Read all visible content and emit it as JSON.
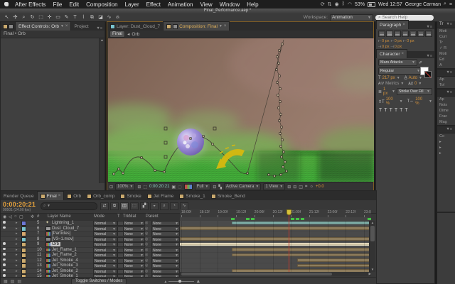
{
  "glyphs": {
    "dropdown": "▼",
    "close": "×",
    "panel_menu": "▼≡",
    "search": "⌕",
    "collapse": "▸",
    "up": "▲",
    "down": "▼",
    "left": "◀",
    "right": "▶",
    "crumb_sep": "◂",
    "pickwhip": "◎"
  },
  "menu_bar": {
    "items": [
      "After Effects",
      "File",
      "Edit",
      "Composition",
      "Layer",
      "Effect",
      "Animation",
      "View",
      "Window",
      "Help"
    ],
    "status_icons": [
      {
        "name": "sync-icon",
        "glyph": "⟳"
      },
      {
        "name": "updown-icon",
        "glyph": "⇅"
      },
      {
        "name": "info-icon",
        "glyph": "◉"
      },
      {
        "name": "bluetooth-icon",
        "glyph": "ᛒ"
      },
      {
        "name": "wifi-icon",
        "glyph": "◠"
      }
    ],
    "battery": "53%",
    "clock": "Wed 12:57",
    "user": "George Carman"
  },
  "title_bar": {
    "title": "Final_Performance.aep *"
  },
  "toolbar": {
    "tools": [
      {
        "name": "selection-tool",
        "glyph": "↖"
      },
      {
        "name": "hand-tool",
        "glyph": "✣"
      },
      {
        "name": "zoom-tool",
        "glyph": "⌕"
      },
      {
        "name": "rotation-tool",
        "glyph": "↻"
      },
      {
        "name": "camera-tool",
        "glyph": "⬚"
      },
      {
        "name": "pan-behind-tool",
        "glyph": "✛"
      },
      {
        "name": "shape-tool",
        "glyph": "▭"
      },
      {
        "name": "pen-tool",
        "glyph": "✎"
      },
      {
        "name": "type-tool",
        "glyph": "T"
      },
      {
        "name": "brush-tool",
        "glyph": "⌇"
      },
      {
        "name": "clone-stamp-tool",
        "glyph": "⧉"
      },
      {
        "name": "eraser-tool",
        "glyph": "◪"
      },
      {
        "name": "roto-brush-tool",
        "glyph": "∿"
      },
      {
        "name": "puppet-pin-tool",
        "glyph": "⍝"
      }
    ],
    "workspace_label": "Workspace:",
    "workspace_value": "Animation",
    "search_placeholder": "Search Help"
  },
  "effect_controls": {
    "tab_main": "Effect Controls: Orb",
    "tab_project": "Project",
    "breadcrumb": "Final • Orb"
  },
  "viewer": {
    "tab_layer": "Layer: Dust_Cloud_7",
    "tab_comp": "Composition: Final",
    "nav_comp": "Final",
    "nav_layer": "Orb",
    "zoom": "100%",
    "timecode": "0:00:20:21",
    "resolution": "Full",
    "camera": "Active Camera",
    "view": "1 View",
    "exposure": "+0.0",
    "icons": {
      "region": "⊡",
      "grid": "⊞",
      "roi": "⬚",
      "snapshot": "▣",
      "snapshot2": "▢",
      "roi2": "⊟",
      "checker": "▚",
      "misc1": "⊞",
      "misc2": "⊟",
      "misc3": "◫",
      "misc4": "⌗",
      "sun": "☼"
    }
  },
  "paragraph_panel": {
    "title": "Paragraph",
    "row1": [
      "0 px",
      "0 px",
      "0 px"
    ],
    "row2": [
      "0 px",
      "0 px"
    ]
  },
  "character_panel": {
    "title": "Character",
    "font": "Mars Attacks",
    "style": "Regular",
    "size": "217 px",
    "leading": "Auto",
    "kerning": "Metrics",
    "tracking": "0",
    "stroke_width": "1 px",
    "stroke_mode": "Stroke Over Fill",
    "vscale": "100 %",
    "hscale": "100 %",
    "faux": [
      "T",
      "T",
      "T",
      "T",
      "T",
      "T"
    ]
  },
  "right_strip": {
    "p1": {
      "tab": "Tr",
      "rows": [
        "Moti",
        "Curr",
        "Tr",
        "✓ R",
        "Moti",
        "Ed",
        "A"
      ]
    },
    "p2": {
      "tab": "",
      "rows": [
        "Ap",
        "Tol"
      ]
    },
    "p3": {
      "tab": "",
      "rows": [
        "Ap",
        "Nois",
        "Dime",
        "Frac",
        "Mag"
      ]
    },
    "p4": {
      "tab": "",
      "rows": [
        "Co"
      ]
    }
  },
  "timeline": {
    "tabs": [
      {
        "label": "Render Queue",
        "active": false,
        "icon": false
      },
      {
        "label": "Final",
        "active": true,
        "icon": true
      },
      {
        "label": "Orb",
        "active": false,
        "icon": true
      },
      {
        "label": "Orb_comp",
        "active": false,
        "icon": true
      },
      {
        "label": "Smoke",
        "active": false,
        "icon": true
      },
      {
        "label": "Jet Flame",
        "active": false,
        "icon": true
      },
      {
        "label": "Smoke_1",
        "active": false,
        "icon": true
      },
      {
        "label": "Smoke_Bend",
        "active": false,
        "icon": true
      }
    ],
    "timecode": "0:00:20:21",
    "frame_info": "00501 (24.00 fps)",
    "columns": {
      "num": "#",
      "name": "Layer Name",
      "mode": "Mode",
      "t": "T",
      "trkmat": "TrkMat",
      "parent": "Parent"
    },
    "toolbar_icons": [
      {
        "name": "comp-flowchart-icon",
        "glyph": "⇄",
        "on": false
      },
      {
        "name": "live-update-icon",
        "glyph": "⧉",
        "on": false
      },
      {
        "name": "draft-3d-icon",
        "glyph": "◫",
        "on": true
      },
      {
        "name": "hide-shy-icon",
        "glyph": "⬚",
        "on": false
      },
      {
        "name": "frame-blend-icon",
        "glyph": "▞",
        "on": false
      },
      {
        "name": "motion-blur-icon",
        "glyph": "◒",
        "on": false
      },
      {
        "name": "brainstorm-icon",
        "glyph": "⌕",
        "on": false
      },
      {
        "name": "auto-keyframe-icon",
        "glyph": "◔",
        "on": false
      },
      {
        "name": "graph-editor-icon",
        "glyph": "∿",
        "on": false
      }
    ],
    "ruler": [
      "18:00f",
      "18:12f",
      "19:00f",
      "19:12f",
      "20:00f",
      "20:12f",
      "21:00f",
      "21:12f",
      "22:00f",
      "22:12f",
      "23:0"
    ],
    "layers": [
      {
        "num": "5",
        "name": "Lightning_1",
        "mode": "Normal",
        "trkmat": "None",
        "parent": "None",
        "label_color": "#6d77d6",
        "icon": "star",
        "eye": true,
        "selected": false,
        "bar": {
          "in": 0.27,
          "out": 1,
          "style": "teal"
        }
      },
      {
        "num": "6",
        "name": "Dust_Cloud_7",
        "mode": "Normal",
        "trkmat": "None",
        "parent": "None",
        "label_color": "#79c4cf",
        "icon": "footage",
        "eye": true,
        "selected": false,
        "bar": {
          "in": 0,
          "out": 1,
          "style": "tan"
        }
      },
      {
        "num": "7",
        "name": "[Particles]",
        "mode": "Normal",
        "trkmat": "None",
        "parent": "None",
        "label_color": "#d9a96e",
        "icon": "comp",
        "eye": false,
        "selected": false,
        "bar": null
      },
      {
        "num": "8",
        "name": "[V3~1.mov]",
        "mode": "Normal",
        "trkmat": "None",
        "parent": "None",
        "label_color": "#79c4cf",
        "icon": "film",
        "eye": false,
        "selected": false,
        "bar": {
          "in": 0,
          "out": 1,
          "style": "tan"
        }
      },
      {
        "num": "9",
        "name": "Orb",
        "mode": "Normal",
        "trkmat": "None",
        "parent": "None",
        "label_color": "#cdab6e",
        "icon": "comp",
        "eye": true,
        "selected": true,
        "bar": {
          "in": 0,
          "out": 1,
          "style": "selected"
        }
      },
      {
        "num": "10",
        "name": "Jet_Flame_1",
        "mode": "Normal",
        "trkmat": "None",
        "parent": "None",
        "label_color": "#cdab6e",
        "icon": "comp",
        "eye": true,
        "selected": false,
        "bar": {
          "in": 0.27,
          "out": 1,
          "style": "tan"
        }
      },
      {
        "num": "11",
        "name": "Jet_Flame_2",
        "mode": "Normal",
        "trkmat": "None",
        "parent": "None",
        "label_color": "#cdab6e",
        "icon": "comp",
        "eye": true,
        "selected": false,
        "bar": {
          "in": 0.27,
          "out": 1,
          "style": "tan"
        }
      },
      {
        "num": "12",
        "name": "Jet_Smoke_4",
        "mode": "Normal",
        "trkmat": "None",
        "parent": "None",
        "label_color": "#cdab6e",
        "icon": "comp",
        "eye": true,
        "selected": false,
        "bar": {
          "in": 0.615,
          "out": 1,
          "style": "tan"
        }
      },
      {
        "num": "13",
        "name": "Jet_Smoke_3",
        "mode": "Normal",
        "trkmat": "None",
        "parent": "None",
        "label_color": "#cdab6e",
        "icon": "comp",
        "eye": true,
        "selected": false,
        "bar": {
          "in": 0.615,
          "out": 1,
          "style": "tan"
        }
      },
      {
        "num": "14",
        "name": "Jet_Smoke_2",
        "mode": "Normal",
        "trkmat": "None",
        "parent": "None",
        "label_color": "#cdab6e",
        "icon": "comp",
        "eye": true,
        "selected": false,
        "bar": {
          "in": 0.27,
          "out": 1,
          "style": "tan"
        }
      },
      {
        "num": "15",
        "name": "Jet_Smoke_1",
        "mode": "Normal",
        "trkmat": "None",
        "parent": "None",
        "label_color": "#cdab6e",
        "icon": "comp",
        "eye": true,
        "selected": false,
        "bar": {
          "in": 0.27,
          "out": 1,
          "style": "tan"
        }
      }
    ],
    "toggle_button": "Toggle Switches / Modes"
  }
}
